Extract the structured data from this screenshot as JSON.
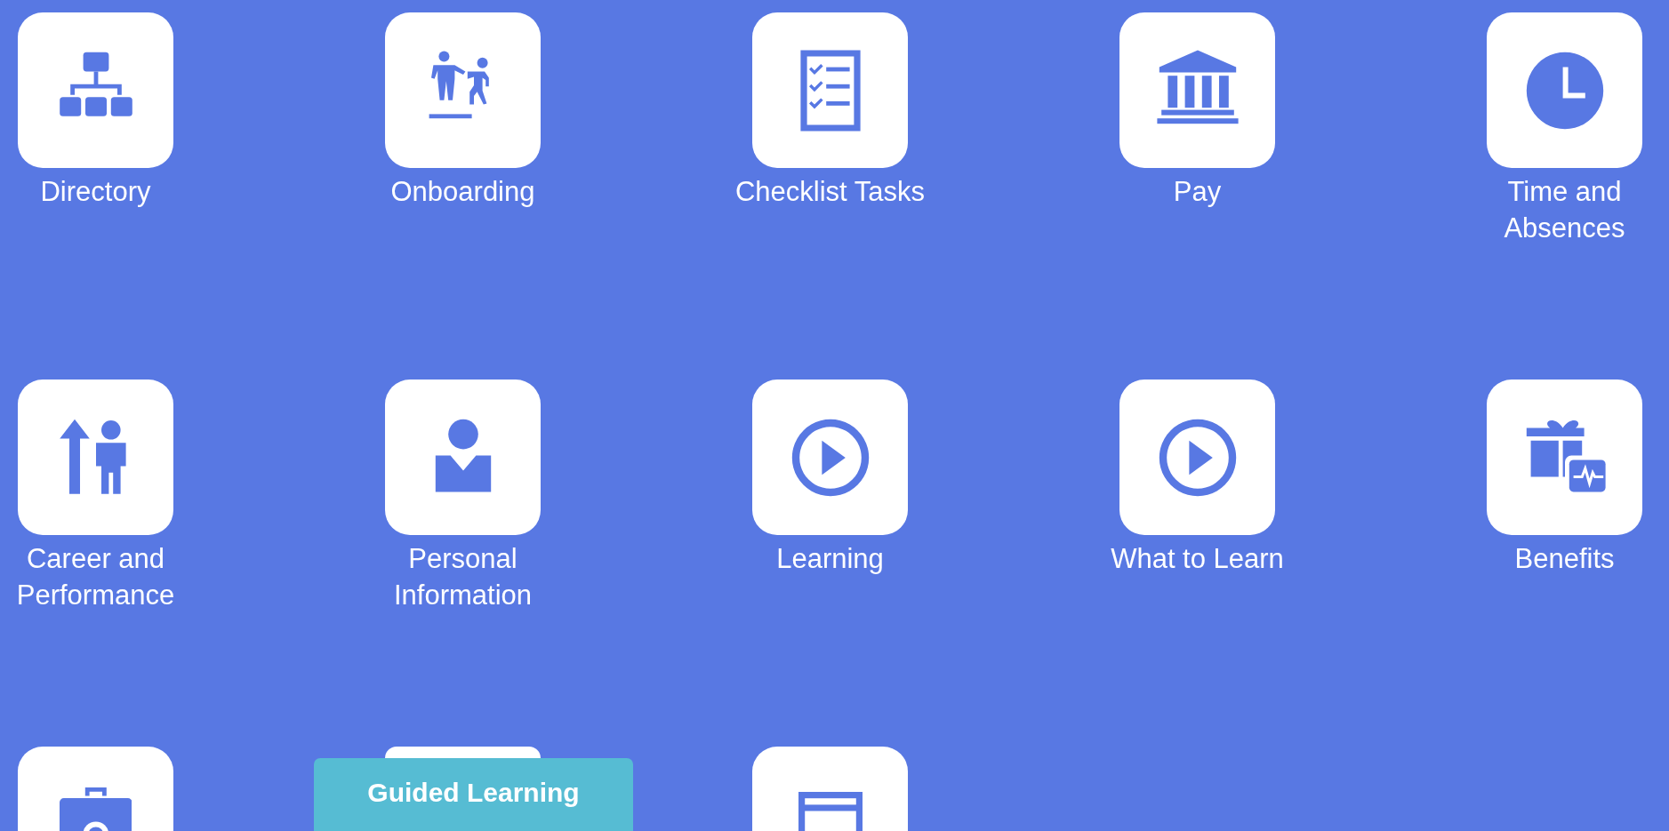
{
  "tiles": [
    {
      "kind": "app",
      "label": "Directory"
    },
    {
      "kind": "app",
      "label": "Onboarding"
    },
    {
      "kind": "app",
      "label": "Checklist Tasks"
    },
    {
      "kind": "app",
      "label": "Pay"
    },
    {
      "kind": "app",
      "label": "Time and\nAbsences"
    },
    {
      "kind": "app",
      "label": "Career and\nPerformance"
    },
    {
      "kind": "app",
      "label": "Personal\nInformation"
    },
    {
      "kind": "app",
      "label": "Learning"
    },
    {
      "kind": "app",
      "label": "What to Learn"
    },
    {
      "kind": "app",
      "label": "Benefits"
    },
    {
      "kind": "app"
    },
    {
      "kind": "app"
    },
    {
      "kind": "app"
    }
  ],
  "guided_learning_button": {
    "label": "Guided Learning"
  }
}
